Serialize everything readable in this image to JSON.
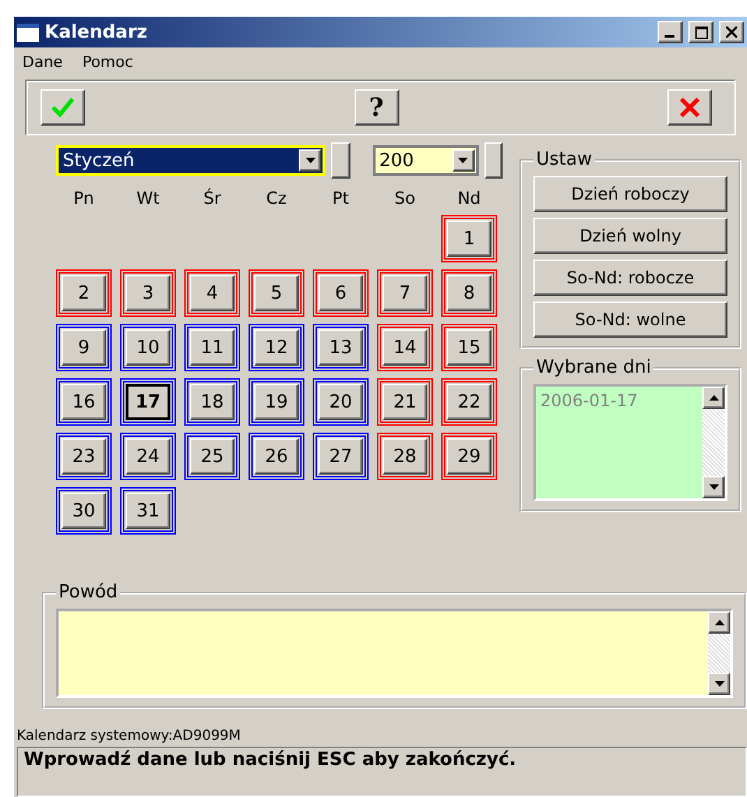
{
  "window": {
    "title": "Kalendarz"
  },
  "menu": [
    "Dane",
    "Pomoc"
  ],
  "toolbar": [
    {
      "kind": "ok"
    },
    {
      "kind": "help",
      "label": "?"
    },
    {
      "kind": "cancel"
    }
  ],
  "month": {
    "value": "Styczeń",
    "focused": true
  },
  "year": {
    "value": "200",
    "focused": false
  },
  "weekdays": [
    "Pn",
    "Wt",
    "Śr",
    "Cz",
    "Pt",
    "So",
    "Nd"
  ],
  "weeks": [
    [
      {
        "label": "1",
        "color": "#ff0000",
        "selected": false
      }
    ],
    [
      {
        "label": "2",
        "color": "#ff0000",
        "selected": false
      },
      {
        "label": "3",
        "color": "#ff0000",
        "selected": false
      },
      {
        "label": "4",
        "color": "#ff0000",
        "selected": false
      },
      {
        "label": "5",
        "color": "#ff0000",
        "selected": false
      },
      {
        "label": "6",
        "color": "#ff0000",
        "selected": false
      },
      {
        "label": "7",
        "color": "#ff0000",
        "selected": false
      },
      {
        "label": "8",
        "color": "#ff0000",
        "selected": false
      }
    ],
    [
      {
        "label": "9",
        "color": "#0000ff",
        "selected": false
      },
      {
        "label": "10",
        "color": "#0000ff",
        "selected": false
      },
      {
        "label": "11",
        "color": "#0000ff",
        "selected": false
      },
      {
        "label": "12",
        "color": "#0000ff",
        "selected": false
      },
      {
        "label": "13",
        "color": "#0000ff",
        "selected": false
      },
      {
        "label": "14",
        "color": "#ff0000",
        "selected": false
      },
      {
        "label": "15",
        "color": "#ff0000",
        "selected": false
      }
    ],
    [
      {
        "label": "16",
        "color": "#0000ff",
        "selected": false
      },
      {
        "label": "17",
        "color": "#0000ff",
        "selected": true
      },
      {
        "label": "18",
        "color": "#0000ff",
        "selected": false
      },
      {
        "label": "19",
        "color": "#0000ff",
        "selected": false
      },
      {
        "label": "20",
        "color": "#0000ff",
        "selected": false
      },
      {
        "label": "21",
        "color": "#ff0000",
        "selected": false
      },
      {
        "label": "22",
        "color": "#ff0000",
        "selected": false
      }
    ],
    [
      {
        "label": "23",
        "color": "#0000ff",
        "selected": false
      },
      {
        "label": "24",
        "color": "#0000ff",
        "selected": false
      },
      {
        "label": "25",
        "color": "#0000ff",
        "selected": false
      },
      {
        "label": "26",
        "color": "#0000ff",
        "selected": false
      },
      {
        "label": "27",
        "color": "#0000ff",
        "selected": false
      },
      {
        "label": "28",
        "color": "#ff0000",
        "selected": false
      },
      {
        "label": "29",
        "color": "#ff0000",
        "selected": false
      }
    ],
    [
      {
        "label": "30",
        "color": "#0000ff",
        "selected": false
      },
      {
        "label": "31",
        "color": "#0000ff",
        "selected": false
      }
    ]
  ],
  "set_panel": {
    "title": "Ustaw",
    "buttons": [
      "Dzień roboczy",
      "Dzień wolny",
      "So-Nd: robocze",
      "So-Nd: wolne"
    ]
  },
  "selected_days": {
    "title": "Wybrane dni",
    "items": [
      "2006-01-17"
    ]
  },
  "reason": {
    "title": "Powód"
  },
  "system_calendar": "Kalendarz systemowy:AD9099M",
  "status_bar": "Wprowadź dane lub naciśnij ESC aby zakończyć."
}
